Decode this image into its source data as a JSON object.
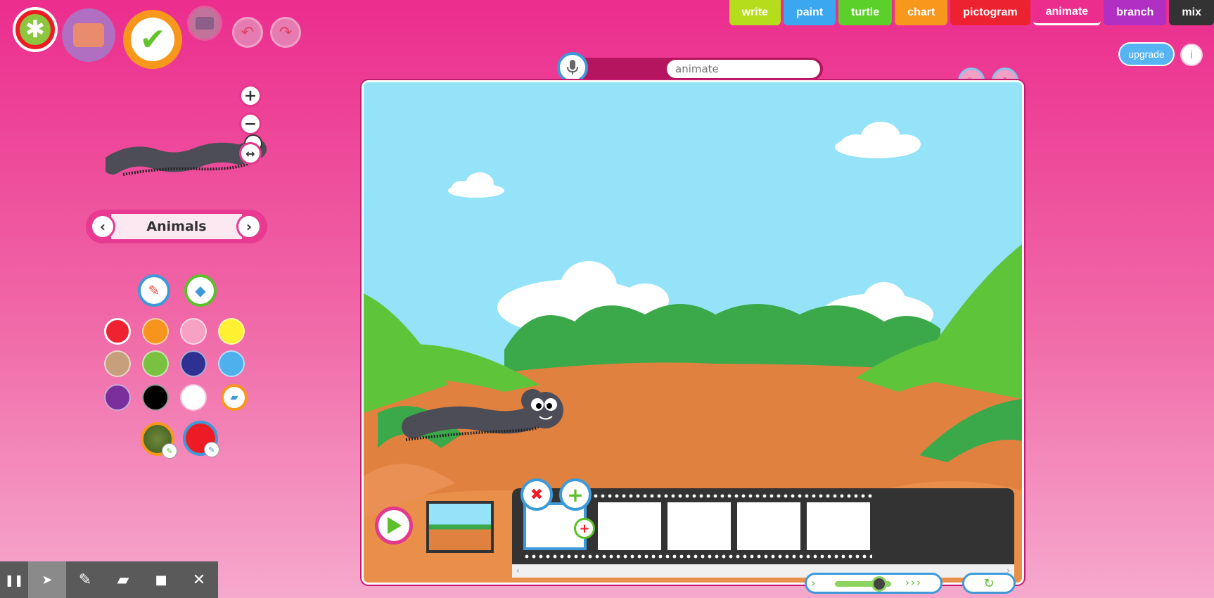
{
  "tabs": [
    {
      "label": "write",
      "color": "#b6dd1c"
    },
    {
      "label": "paint",
      "color": "#3aa7f0"
    },
    {
      "label": "turtle",
      "color": "#5bcf2a"
    },
    {
      "label": "chart",
      "color": "#f7981d"
    },
    {
      "label": "pictogram",
      "color": "#ec2230"
    },
    {
      "label": "animate",
      "color": "#ec2d8e"
    },
    {
      "label": "branch",
      "color": "#b12fc2"
    },
    {
      "label": "mix",
      "color": "#333333"
    }
  ],
  "header": {
    "upgrade_label": "upgrade",
    "info_label": "i"
  },
  "title_field": {
    "value": "animate"
  },
  "category": {
    "label": "Animals"
  },
  "palette": {
    "colors": [
      "#ee2231",
      "#f7941d",
      "#f7a1c4",
      "#fef131",
      "#c6a07c",
      "#7ac142",
      "#2e3192",
      "#4fb0ee",
      "#7b2f9d",
      "#000000",
      "#ffffff"
    ]
  },
  "toolbar": {
    "pause": "❚❚",
    "select": "➤",
    "pen": "✎",
    "eraser": "▰",
    "camera": "■",
    "close": "✕"
  },
  "icons": {
    "mic": "mic-icon",
    "play": "play-icon",
    "reload": "reload-icon"
  }
}
